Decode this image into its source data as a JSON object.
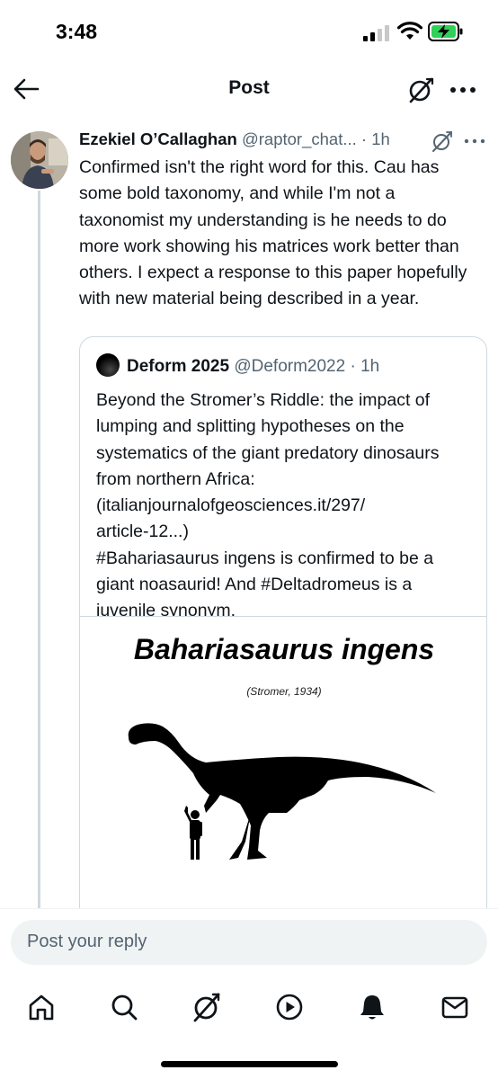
{
  "status_bar": {
    "time": "3:48"
  },
  "nav": {
    "title": "Post"
  },
  "tweet": {
    "author_name": "Ezekiel O’Callaghan",
    "author_handle": "@raptor_chat...",
    "time": "1h",
    "text": "Confirmed isn't the right word for this. Cau has some bold taxonomy, and while I'm not a taxonomist my understanding is he needs to do more work showing his matrices work better than others. I expect a response to this paper hopefully with new material being described in a year."
  },
  "quote": {
    "author_name": "Deform 2025",
    "author_handle": "@Deform2022",
    "time": "1h",
    "text_lines": [
      "Beyond the Stromer’s Riddle: the impact of lumping and splitting hypotheses on the systematics of the giant predatory dinosaurs from northern Africa: (italianjournalofgeosciences.it/297/",
      "article-12...)",
      "#Bahariasaurus ingens is confirmed to be a giant noasaurid! And #Deltadromeus is a juvenile synonym."
    ],
    "media": {
      "title": "Bahariasaurus ingens",
      "subtitle": "(Stromer, 1934)"
    }
  },
  "reply": {
    "placeholder": "Post your reply"
  },
  "tabs": [
    "home-icon",
    "search-icon",
    "grok-icon",
    "video-icon",
    "notifications-icon",
    "messages-icon"
  ]
}
